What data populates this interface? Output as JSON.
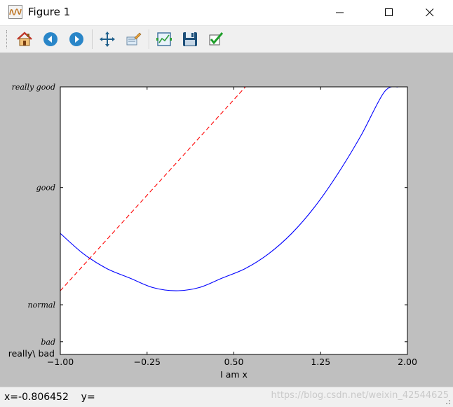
{
  "window": {
    "title": "Figure 1"
  },
  "toolbar": {
    "buttons": [
      {
        "name": "home-button",
        "icon": "home-icon"
      },
      {
        "name": "back-button",
        "icon": "arrow-left-icon"
      },
      {
        "name": "forward-button",
        "icon": "arrow-right-icon"
      },
      {
        "name": "pan-button",
        "icon": "move-icon"
      },
      {
        "name": "zoom-button",
        "icon": "zoom-rect-icon"
      },
      {
        "name": "subplots-button",
        "icon": "subplots-icon"
      },
      {
        "name": "save-button",
        "icon": "floppy-disk-icon"
      },
      {
        "name": "edit-axis-button",
        "icon": "check-icon"
      }
    ]
  },
  "status": {
    "coords": "x=-0.806452    y="
  },
  "watermark": "https://blog.csdn.net/weixin_42544625",
  "chart_data": {
    "type": "line",
    "xlabel": "I am x",
    "ylabel": "",
    "title": "",
    "xlim": [
      -1,
      2
    ],
    "ylim": [
      -2,
      2.2
    ],
    "xticks": [
      -1.0,
      -0.25,
      0.5,
      1.25,
      2.0
    ],
    "xtick_labels": [
      "−1.00",
      "−0.25",
      "0.50",
      "1.25",
      "2.00"
    ],
    "yticks": [
      -1.8,
      -1.22,
      0.62,
      2.2
    ],
    "ytick_labels": [
      "$really\\ bad$",
      "$bad$",
      "$normal$",
      "$good$",
      "$really\\ good$"
    ],
    "ytick_label_texts": [
      "really\\ bad",
      "bad",
      "normal",
      "good",
      "really good"
    ],
    "series": [
      {
        "color": "#0000ff",
        "linestyle": "solid",
        "x": [
          -1.0,
          -0.8,
          -0.6,
          -0.4,
          -0.2,
          0.0,
          0.2,
          0.4,
          0.6,
          0.8,
          1.0,
          1.2,
          1.4,
          1.6,
          1.8,
          1.92
        ],
        "y": [
          -0.1,
          -0.42,
          -0.65,
          -0.8,
          -0.95,
          -1.0,
          -0.95,
          -0.8,
          -0.65,
          -0.42,
          -0.1,
          0.32,
          0.84,
          1.44,
          2.12,
          2.2
        ]
      },
      {
        "color": "#ff0000",
        "linestyle": "dashed",
        "x": [
          -1.0,
          1.0
        ],
        "y": [
          -1.0,
          3.0
        ]
      }
    ]
  }
}
